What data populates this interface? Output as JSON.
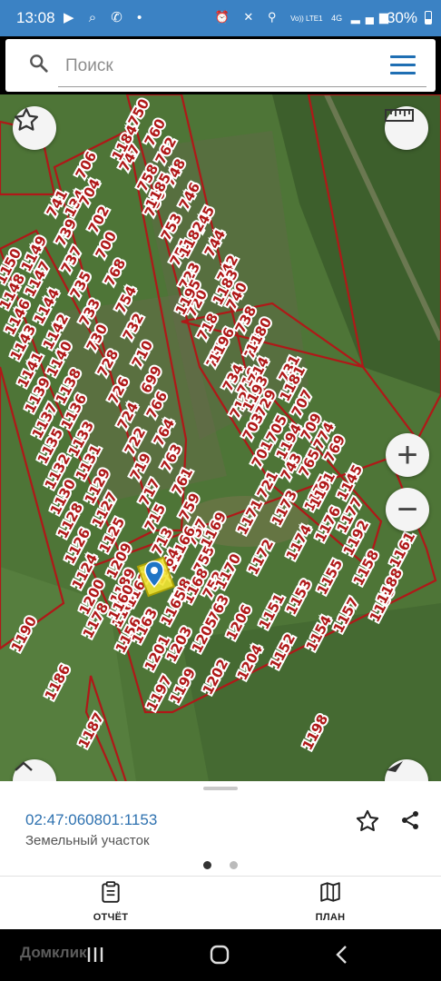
{
  "status_bar": {
    "time": "13:08",
    "network_small": "Vo)) LTE1",
    "network_gen": "4G",
    "battery": "30%"
  },
  "search": {
    "placeholder": "Поиск"
  },
  "map": {
    "parcel_numbers": [
      "134",
      "750",
      "760",
      "762",
      "747",
      "758",
      "748",
      "756",
      "746",
      "753",
      "745",
      "751",
      "744",
      "723",
      "742",
      "720",
      "740",
      "718",
      "738",
      "736",
      "727",
      "716",
      "734",
      "714",
      "731",
      "729",
      "712",
      "707",
      "705",
      "703",
      "709",
      "701",
      "769",
      "765",
      "743",
      "721",
      "706",
      "704",
      "741",
      "702",
      "739",
      "700",
      "737",
      "768",
      "735",
      "754",
      "733",
      "732",
      "730",
      "710",
      "728",
      "699",
      "726",
      "766",
      "724",
      "764",
      "722",
      "763",
      "719",
      "761",
      "717",
      "759",
      "715",
      "757",
      "713",
      "755",
      "711",
      "752",
      "708",
      "763",
      "1150",
      "1149",
      "1148",
      "1147",
      "1146",
      "1144",
      "1143",
      "1142",
      "1141",
      "1140",
      "1139",
      "1138",
      "1137",
      "1136",
      "1135",
      "1133",
      "1132",
      "1131",
      "1130",
      "1129",
      "1128",
      "1127",
      "1126",
      "1125",
      "1124",
      "1209",
      "1200",
      "1189",
      "1178",
      "1167",
      "1156",
      "1145",
      "1177",
      "1175",
      "1176",
      "1173",
      "1174",
      "1171",
      "1172",
      "1169",
      "1170",
      "1166",
      "1168",
      "1164",
      "1165",
      "1162",
      "1163",
      "1160",
      "1161",
      "1158",
      "1159",
      "1155",
      "1157",
      "1153",
      "1154",
      "1151",
      "1152",
      "1206",
      "1204",
      "1205",
      "1202",
      "1203",
      "1199",
      "1201",
      "1197",
      "1198",
      "1195",
      "1196",
      "1193",
      "1194",
      "1191",
      "1192",
      "1188",
      "1190",
      "1186",
      "1187",
      "1184",
      "1185",
      "1182",
      "1183",
      "1180",
      "1181",
      "774"
    ],
    "selected_parcel": "1153"
  },
  "parcel": {
    "cadastral_number": "02:47:060801:1153",
    "type": "Земельный участок"
  },
  "bottom_nav": {
    "report_label": "ОТЧЁТ",
    "plan_label": "ПЛАН"
  },
  "watermark": "Домклик",
  "colors": {
    "accent": "#3b82c4",
    "parcel_border": "#b01818",
    "selected": "#f2e533"
  }
}
